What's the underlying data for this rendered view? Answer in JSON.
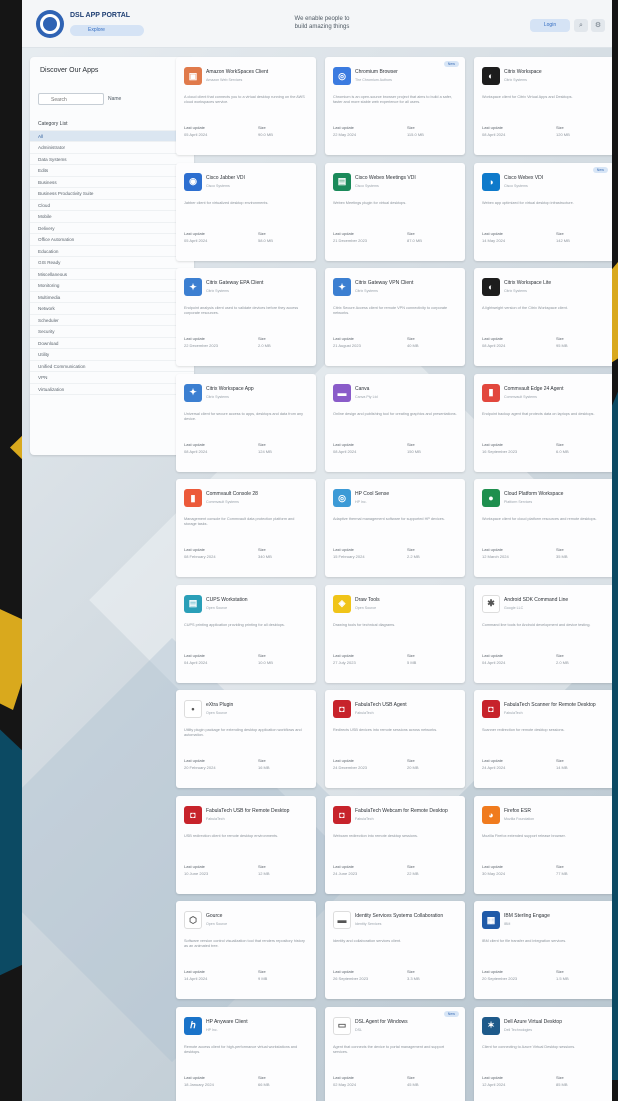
{
  "header": {
    "app_title": "DSL APP PORTAL",
    "logout_label": "Explore",
    "tagline_line1": "We enable people to",
    "tagline_line2": "build amazing things",
    "login_label": "Login",
    "search_glyph": "⌕",
    "settings_glyph": "⚙"
  },
  "sidebar": {
    "title": "Discover Our Apps",
    "search_placeholder": "Search",
    "sort_label": "Name",
    "categories_header": "Category List",
    "items": [
      "All",
      "Administrator",
      "Data Systems",
      "Edits",
      "Business",
      "Business Productivity Suite",
      "Cloud",
      "Mobile",
      "Delivery",
      "Office Automation",
      "Education",
      "GIS Ready",
      "Miscellaneous",
      "Monitoring",
      "Multimedia",
      "Network",
      "Scheduler",
      "Security",
      "Download",
      "Utility",
      "Unified Communication",
      "VPN",
      "Virtualization"
    ]
  },
  "labels": {
    "last_update": "Last update",
    "size": "Size",
    "new_badge": "New"
  },
  "apps": [
    {
      "title": "Amazon WorkSpaces Client",
      "vendor": "Amazon Web Services",
      "desc": "A cloud client that connects you to a virtual desktop running on the AWS cloud workspaces service.",
      "updated": "05 April 2024",
      "size": "90.0 MB",
      "icon_color": "#e07a4b",
      "icon_glyph": "▣",
      "is_new": false
    },
    {
      "title": "Chromium Browser",
      "vendor": "The Chromium Authors",
      "desc": "Chromium is an open-source browser project that aims to build a safer, faster and more stable web experience for all users.",
      "updated": "22 May 2024",
      "size": "115.0 MB",
      "icon_color": "#3b7be0",
      "icon_glyph": "◎",
      "is_new": true
    },
    {
      "title": "Citrix Workspace",
      "vendor": "Citrix Systems",
      "desc": "Workspace client for Citrix Virtual Apps and Desktops.",
      "updated": "08 April 2024",
      "size": "120 MB",
      "icon_color": "#1d1d1d",
      "icon_glyph": "◐",
      "is_new": false
    },
    {
      "title": "Cisco Jabber VDI",
      "vendor": "Cisco Systems",
      "desc": "Jabber client for virtualized desktop environments.",
      "updated": "05 April 2024",
      "size": "58.0 MB",
      "icon_color": "#2d6fd0",
      "icon_glyph": "◉",
      "is_new": false
    },
    {
      "title": "Cisco Webex Meetings VDI",
      "vendor": "Cisco Systems",
      "desc": "Webex Meetings plugin for virtual desktops.",
      "updated": "21 December 2023",
      "size": "87.0 MB",
      "icon_color": "#1b8a5a",
      "icon_glyph": "▤",
      "is_new": false
    },
    {
      "title": "Cisco Webex VDI",
      "vendor": "Cisco Systems",
      "desc": "Webex app optimized for virtual desktop infrastructure.",
      "updated": "14 May 2024",
      "size": "142 MB",
      "icon_color": "#0e7acb",
      "icon_glyph": "◑",
      "is_new": true
    },
    {
      "title": "Citrix Gateway EPA Client",
      "vendor": "Citrix Systems",
      "desc": "Endpoint analysis client used to validate devices before they access corporate resources.",
      "updated": "22 December 2023",
      "size": "2.0 MB",
      "icon_color": "#3c7fd1",
      "icon_glyph": "✦",
      "is_new": false
    },
    {
      "title": "Citrix Gateway VPN Client",
      "vendor": "Citrix Systems",
      "desc": "Citrix Secure Access client for remote VPN connectivity to corporate networks.",
      "updated": "21 August 2023",
      "size": "40 MB",
      "icon_color": "#3c7fd1",
      "icon_glyph": "✦",
      "is_new": false
    },
    {
      "title": "Citrix Workspace Lite",
      "vendor": "Citrix Systems",
      "desc": "A lightweight version of the Citrix Workspace client.",
      "updated": "08 April 2024",
      "size": "95 MB",
      "icon_color": "#1d1d1d",
      "icon_glyph": "◐",
      "is_new": false
    },
    {
      "title": "Citrix Workspace App",
      "vendor": "Citrix Systems",
      "desc": "Universal client for secure access to apps, desktops and data from any device.",
      "updated": "08 April 2024",
      "size": "124 MB",
      "icon_color": "#3c7fd1",
      "icon_glyph": "✦",
      "is_new": false
    },
    {
      "title": "Canva",
      "vendor": "Canva Pty Ltd",
      "desc": "Online design and publishing tool for creating graphics and presentations.",
      "updated": "08 April 2024",
      "size": "150 MB",
      "icon_color": "#8a5cc9",
      "icon_glyph": "▬",
      "is_new": false
    },
    {
      "title": "Commvault Edge 24 Agent",
      "vendor": "Commvault Systems",
      "desc": "Endpoint backup agent that protects data on laptops and desktops.",
      "updated": "16 September 2023",
      "size": "6.0 MB",
      "icon_color": "#e2473d",
      "icon_glyph": "▮",
      "is_new": false
    },
    {
      "title": "Commvault Console 28",
      "vendor": "Commvault Systems",
      "desc": "Management console for Commvault data protection platform and storage tasks.",
      "updated": "08 February 2024",
      "size": "340 MB",
      "icon_color": "#ec5a3a",
      "icon_glyph": "▮",
      "is_new": false
    },
    {
      "title": "HP Cool Sense",
      "vendor": "HP Inc.",
      "desc": "Adaptive thermal management software for supported HP devices.",
      "updated": "15 February 2024",
      "size": "2.2 MB",
      "icon_color": "#3c9ad6",
      "icon_glyph": "◎",
      "is_new": false
    },
    {
      "title": "Cloud Platform Workspace",
      "vendor": "Platform Services",
      "desc": "Workspace client for cloud platform resources and remote desktops.",
      "updated": "12 March 2024",
      "size": "35 MB",
      "icon_color": "#1e8f4e",
      "icon_glyph": "●",
      "is_new": false
    },
    {
      "title": "CUPS Workstation",
      "vendor": "Open Source",
      "desc": "CUPS printing application providing printing for all desktops.",
      "updated": "04 April 2024",
      "size": "10.0 MB",
      "icon_color": "#2a9fb8",
      "icon_glyph": "▤",
      "is_new": false
    },
    {
      "title": "Draw Tools",
      "vendor": "Open Source",
      "desc": "Drawing tools for technical diagrams.",
      "updated": "27 July 2023",
      "size": "5 MB",
      "icon_color": "#f0c419",
      "icon_glyph": "◈",
      "is_new": false
    },
    {
      "title": "Android SDK Command Line",
      "vendor": "Google LLC",
      "desc": "Command line tools for Android development and device testing.",
      "updated": "04 April 2024",
      "size": "2.0 MB",
      "icon_color": "#ffffff",
      "icon_glyph": "✱",
      "is_new": false
    },
    {
      "title": "eXtra Plugin",
      "vendor": "Open Source",
      "desc": "Utility plugin package for extending desktop application workflows and automation.",
      "updated": "20 February 2024",
      "size": "16 MB",
      "icon_color": "#ffffff",
      "icon_glyph": "•",
      "is_new": false
    },
    {
      "title": "FabulaTech USB Agent",
      "vendor": "FabulaTech",
      "desc": "Redirects USB devices into remote sessions across networks.",
      "updated": "24 December 2023",
      "size": "20 MB",
      "icon_color": "#c7232b",
      "icon_glyph": "◘",
      "is_new": false
    },
    {
      "title": "FabulaTech Scanner for Remote Desktop",
      "vendor": "FabulaTech",
      "desc": "Scanner redirection for remote desktop sessions.",
      "updated": "24 April 2024",
      "size": "14 MB",
      "icon_color": "#c7232b",
      "icon_glyph": "◘",
      "is_new": false
    },
    {
      "title": "FabulaTech USB for Remote Desktop",
      "vendor": "FabulaTech",
      "desc": "USB redirection client for remote desktop environments.",
      "updated": "10 June 2023",
      "size": "12 MB",
      "icon_color": "#c7232b",
      "icon_glyph": "◘",
      "is_new": false
    },
    {
      "title": "FabulaTech Webcam for Remote Desktop",
      "vendor": "FabulaTech",
      "desc": "Webcam redirection into remote desktop sessions.",
      "updated": "24 June 2023",
      "size": "22 MB",
      "icon_color": "#c7232b",
      "icon_glyph": "◘",
      "is_new": false
    },
    {
      "title": "Firefox ESR",
      "vendor": "Mozilla Foundation",
      "desc": "Mozilla Firefox extended support release browser.",
      "updated": "30 May 2024",
      "size": "77 MB",
      "icon_color": "#f07b1e",
      "icon_glyph": "◕",
      "is_new": false
    },
    {
      "title": "Gource",
      "vendor": "Open Source",
      "desc": "Software version control visualization tool that renders repository history as an animated tree.",
      "updated": "14 April 2024",
      "size": "9 MB",
      "icon_color": "#ffffff",
      "icon_glyph": "⬡",
      "is_new": false
    },
    {
      "title": "Identity Services Systems Collaboration",
      "vendor": "Identity Services",
      "desc": "Identity and collaboration services client.",
      "updated": "26 September 2023",
      "size": "3.3 MB",
      "icon_color": "#ffffff",
      "icon_glyph": "▬",
      "is_new": false
    },
    {
      "title": "IBM Sterling Engage",
      "vendor": "IBM",
      "desc": "IBM client for file transfer and integration services.",
      "updated": "20 September 2023",
      "size": "1.5 MB",
      "icon_color": "#1f5aa8",
      "icon_glyph": "▦",
      "is_new": false
    },
    {
      "title": "HP Anyware Client",
      "vendor": "HP Inc.",
      "desc": "Remote access client for high-performance virtual workstations and desktops.",
      "updated": "18 January 2024",
      "size": "66 MB",
      "icon_color": "#1a73c9",
      "icon_glyph": "ℎ",
      "is_new": false
    },
    {
      "title": "DSL Agent for Windows",
      "vendor": "DSL",
      "desc": "Agent that connects the device to portal management and support services.",
      "updated": "02 May 2024",
      "size": "45 MB",
      "icon_color": "#ffffff",
      "icon_glyph": "▭",
      "is_new": true
    },
    {
      "title": "Dell Azure Virtual Desktop",
      "vendor": "Dell Technologies",
      "desc": "Client for connecting to Azure Virtual Desktop sessions.",
      "updated": "12 April 2024",
      "size": "85 MB",
      "icon_color": "#1e5a8a",
      "icon_glyph": "✶",
      "is_new": false
    }
  ]
}
